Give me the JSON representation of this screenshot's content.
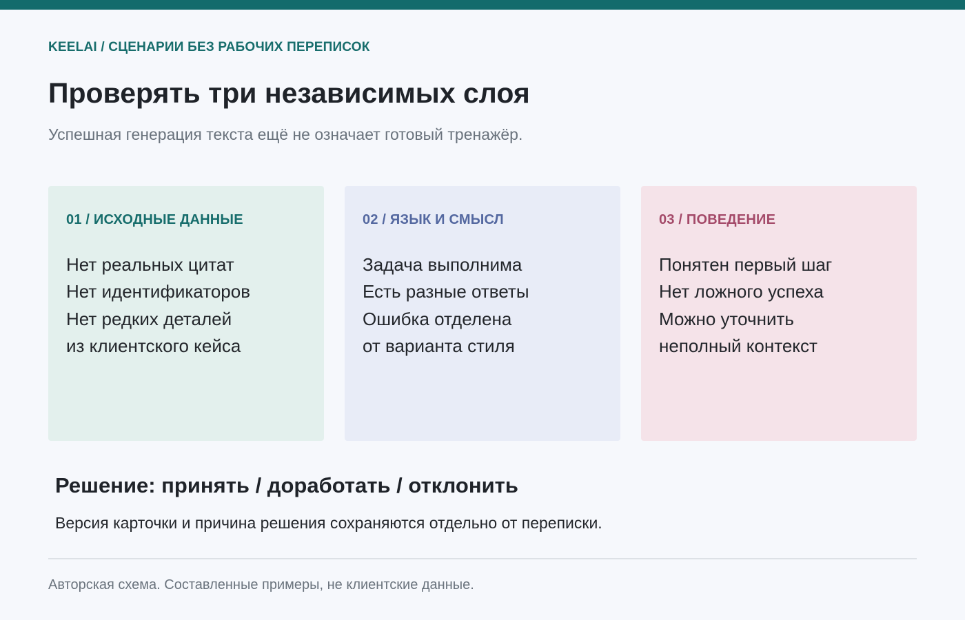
{
  "header": {
    "breadcrumb": "KEELAI / СЦЕНАРИИ БЕЗ РАБОЧИХ ПЕРЕПИСОК",
    "title": "Проверять три независимых слоя",
    "subtitle": "Успешная генерация текста ещё не означает готовый тренажёр."
  },
  "cards": [
    {
      "heading": "01 / ИСХОДНЫЕ ДАННЫЕ",
      "lines": [
        "Нет реальных цитат",
        "Нет идентификаторов",
        "Нет редких деталей",
        "из клиентского кейса"
      ],
      "bg_color": "#e3f0ed",
      "accent_color": "#176d6c"
    },
    {
      "heading": "02 / ЯЗЫК И СМЫСЛ",
      "lines": [
        "Задача выполнима",
        "Есть разные ответы",
        "Ошибка отделена",
        "от варианта стиля"
      ],
      "bg_color": "#e8ecf7",
      "accent_color": "#5468a0"
    },
    {
      "heading": "03 / ПОВЕДЕНИЕ",
      "lines": [
        "Понятен первый шаг",
        "Нет ложного успеха",
        "Можно уточнить",
        "неполный контекст"
      ],
      "bg_color": "#f5e3e9",
      "accent_color": "#a44a69"
    }
  ],
  "decision": {
    "title": "Решение: принять / доработать / отклонить",
    "text": "Версия карточки и причина решения сохраняются отдельно от переписки."
  },
  "footer": {
    "note": "Авторская схема. Составленные примеры, не клиентские данные."
  },
  "colors": {
    "accent_bar": "#136b6c",
    "background": "#f6f8fc"
  }
}
